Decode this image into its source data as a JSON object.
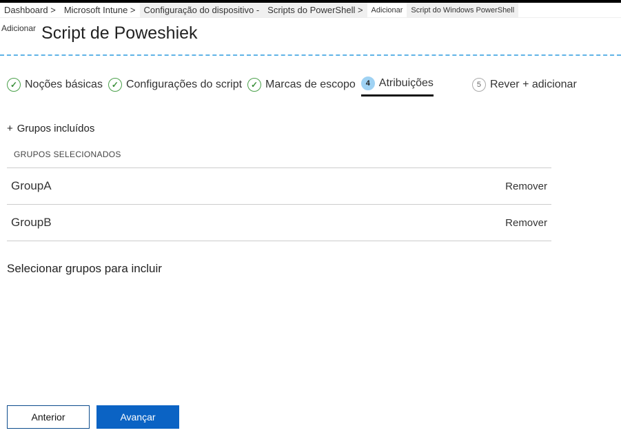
{
  "breadcrumbs": {
    "items": [
      {
        "label": "Dashboard >",
        "shaded": false,
        "small": false
      },
      {
        "label": "Microsoft Intune >",
        "shaded": false,
        "small": false
      },
      {
        "label": "Configuração do dispositivo -",
        "shaded": true,
        "small": false
      },
      {
        "label": "Scripts do PowerShell >",
        "shaded": true,
        "small": false
      },
      {
        "label": "Adicionar",
        "shaded": false,
        "small": true
      },
      {
        "label": "Script do Windows PowerShell",
        "shaded": true,
        "small": true
      }
    ]
  },
  "header": {
    "overline": "Adicionar",
    "title": "Script de Poweshiek"
  },
  "wizard": {
    "steps": [
      {
        "id": "basics",
        "label": "Noções básicas",
        "state": "done"
      },
      {
        "id": "config",
        "label": "Configurações do script",
        "state": "done"
      },
      {
        "id": "scope",
        "label": "Marcas de escopo",
        "state": "done"
      },
      {
        "id": "assign",
        "label": "Atribuições",
        "state": "current",
        "num": "4"
      },
      {
        "id": "review",
        "label": "Rever + adicionar",
        "state": "pending",
        "num": "5"
      }
    ]
  },
  "assignments": {
    "add_groups_label": "Grupos incluídos",
    "section_label": "GRUPOS SELECIONADOS",
    "groups": [
      {
        "name": "GroupA"
      },
      {
        "name": "GroupB"
      }
    ],
    "remove_label": "Remover",
    "select_more_label": "Selecionar grupos para incluir"
  },
  "footer": {
    "previous": "Anterior",
    "next": "Avançar"
  }
}
